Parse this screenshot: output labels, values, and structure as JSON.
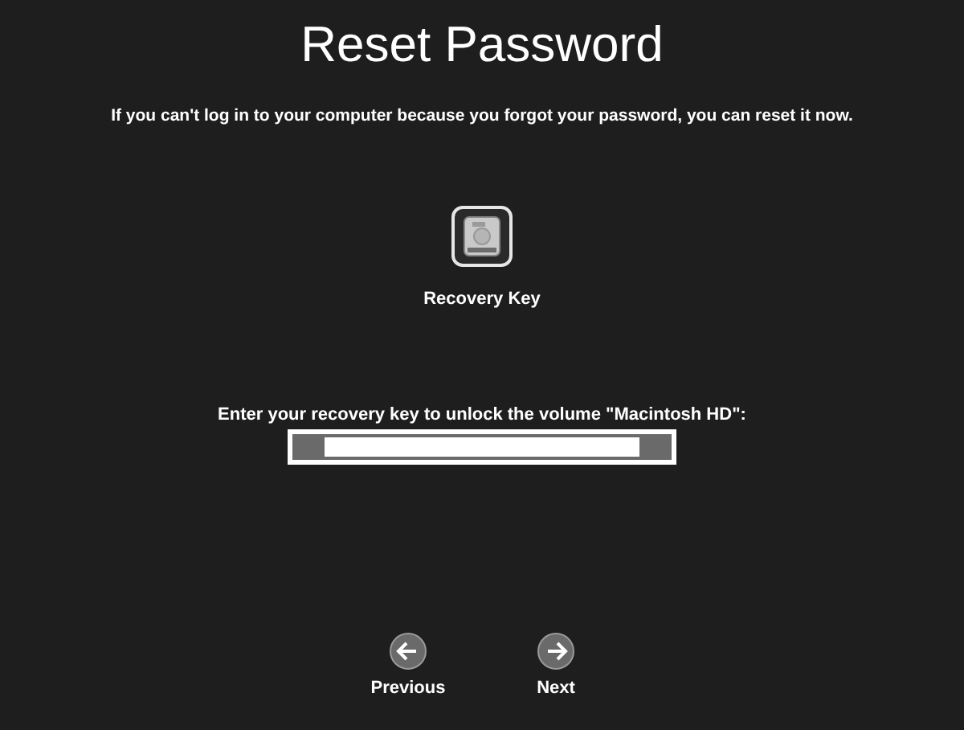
{
  "title": "Reset Password",
  "subtitle": "If you can't log in to your computer because you forgot your password, you can reset it now.",
  "option": {
    "label": "Recovery Key",
    "selected": true
  },
  "prompt": "Enter your recovery key to unlock the volume \"Macintosh HD\":",
  "nav": [
    {
      "kind": "previous",
      "label": "Previous"
    },
    {
      "kind": "next",
      "label": "Next"
    }
  ]
}
